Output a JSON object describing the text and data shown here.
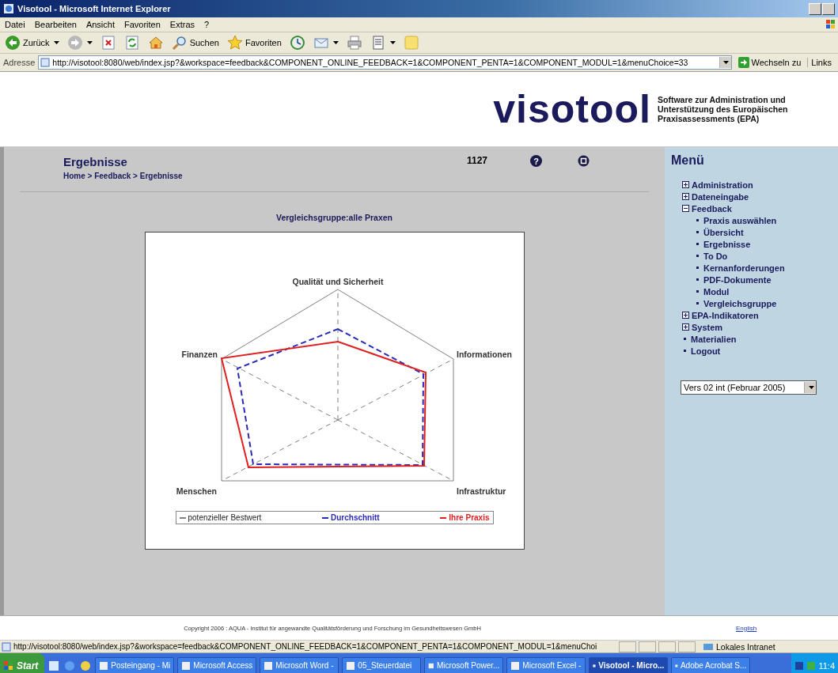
{
  "window": {
    "title": "Visotool - Microsoft Internet Explorer"
  },
  "menu_bar": [
    "Datei",
    "Bearbeiten",
    "Ansicht",
    "Favoriten",
    "Extras",
    "?"
  ],
  "toolbar": [
    {
      "kind": "back",
      "label": "Zurück",
      "dropdown": true
    },
    {
      "kind": "forward",
      "dropdown": true
    },
    {
      "kind": "stop"
    },
    {
      "kind": "refresh"
    },
    {
      "kind": "home"
    },
    {
      "kind": "search",
      "label": "Suchen"
    },
    {
      "kind": "favorites",
      "label": "Favoriten"
    },
    {
      "kind": "history"
    },
    {
      "kind": "mail",
      "dropdown": true
    },
    {
      "kind": "print"
    },
    {
      "kind": "editor",
      "dropdown": true
    },
    {
      "kind": "notes"
    }
  ],
  "address_bar": {
    "label": "Adresse",
    "url": "http://visotool:8080/web/index.jsp?&workspace=feedback&COMPONENT_ONLINE_FEEDBACK=1&COMPONENT_PENTA=1&COMPONENT_MODUL=1&menuChoice=33",
    "go": "Wechseln zu",
    "links": "Links"
  },
  "header": {
    "logo": "visotool",
    "tagline": "Software zur Administration und Unterstützung des Europäischen Praxisassessments (EPA)"
  },
  "page": {
    "title": "Ergebnisse",
    "breadcrumb": "Home > Feedback > Ergebnisse",
    "number": "1127",
    "help": "?",
    "subtitle": "Vergleichsgruppe:alle Praxen",
    "chart": {
      "axes": [
        "Qualität und Sicherheit",
        "Informationen",
        "Infrastruktur",
        "Menschen",
        "Finanzen"
      ],
      "legend": [
        {
          "label": "potenzieller Bestwert",
          "color": "#808080"
        },
        {
          "label": "Durchschnitt",
          "color": "#2a2ab8"
        },
        {
          "label": "Ihre Praxis",
          "color": "#e02020"
        }
      ]
    }
  },
  "sidebar": {
    "title": "Menü",
    "items": [
      {
        "label": "Administration",
        "kind": "group",
        "expanded": false
      },
      {
        "label": "Dateneingabe",
        "kind": "group",
        "expanded": false
      },
      {
        "label": "Feedback",
        "kind": "group",
        "expanded": true,
        "children": [
          {
            "label": "Praxis auswählen"
          },
          {
            "label": "Übersicht"
          },
          {
            "label": "Ergebnisse"
          },
          {
            "label": "To Do"
          },
          {
            "label": "Kernanforderungen"
          },
          {
            "label": "PDF-Dokumente"
          },
          {
            "label": "Modul"
          },
          {
            "label": "Vergleichsgruppe"
          }
        ]
      },
      {
        "label": "EPA-Indikatoren",
        "kind": "group",
        "expanded": false
      },
      {
        "label": "System",
        "kind": "group",
        "expanded": false
      },
      {
        "label": "Materialien",
        "kind": "link"
      },
      {
        "label": "Logout",
        "kind": "link"
      }
    ],
    "version_select": "Vers 02 int (Februar 2005)"
  },
  "footer": {
    "copyright": "Copyright 2006 : AQUA - Institut für angewandte Qualitätsförderung und Forschung im Gesundheitswesen GmbH",
    "link": "English"
  },
  "status_bar": {
    "url": "http://visotool:8080/web/index.jsp?&workspace=feedback&COMPONENT_ONLINE_FEEDBACK=1&COMPONENT_PENTA=1&COMPONENT_MODUL=1&menuChoi",
    "zone": "Lokales Intranet"
  },
  "taskbar": {
    "start": "Start",
    "tasks": [
      {
        "label": "Posteingang - Mi",
        "selected": false
      },
      {
        "label": "Microsoft Access",
        "selected": false
      },
      {
        "label": "Microsoft Word -",
        "selected": false
      },
      {
        "label": "05_Steuerdatei",
        "selected": false
      },
      {
        "label": "Microsoft Power...",
        "selected": false
      },
      {
        "label": "Microsoft Excel -",
        "selected": false
      },
      {
        "label": "Visotool - Micro...",
        "selected": true
      },
      {
        "label": "Adobe Acrobat S...",
        "selected": false
      }
    ],
    "clock": "11:4"
  }
}
